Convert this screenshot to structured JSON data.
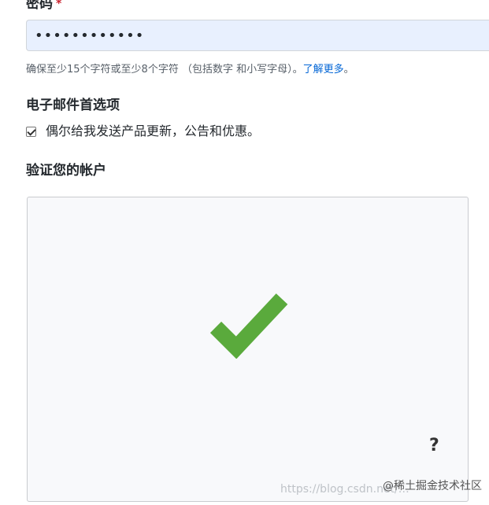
{
  "password": {
    "label": "密码",
    "required_mark": "*",
    "value": "••••••••••••",
    "hint_text": "确保至少15个字符或至少8个字符 （包括数字 和小写字母）。",
    "hint_link": "了解更多",
    "hint_suffix": "。"
  },
  "email_preferences": {
    "title": "电子邮件首选项",
    "checkbox_label": "偶尔给我发送产品更新，公告和优惠。",
    "checked": true
  },
  "verify": {
    "title": "验证您的帐户",
    "help_glyph": "?"
  },
  "watermarks": {
    "url": "https://blog.csdn.net/…",
    "juejin": "@稀土掘金技术社区"
  },
  "colors": {
    "check_green": "#5aaa3c",
    "link": "#0366d6",
    "input_bg": "#e8f0fe"
  },
  "icons": {
    "check": "check-mark-icon",
    "help": "question-mark-icon"
  }
}
